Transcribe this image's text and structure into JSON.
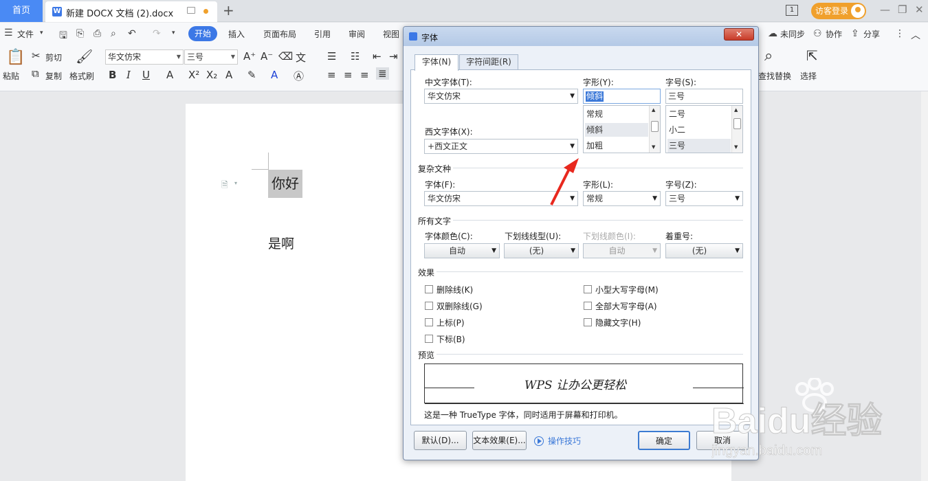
{
  "tabbar": {
    "home_label": "首页",
    "doc_icon": "W",
    "doc_name": "新建 DOCX 文档 (2).docx",
    "new_tab": "+",
    "page_count": "1",
    "login_label": "访客登录",
    "win_minimize": "—",
    "win_restore": "❐",
    "win_close": "✕"
  },
  "menubar": {
    "file_label": "文件",
    "start_label": "开始",
    "insert_label": "插入",
    "layout_label": "页面布局",
    "ref_label": "引用",
    "review_label": "审阅",
    "view_label": "视图",
    "sync_label": "未同步",
    "collab_label": "协作",
    "share_label": "分享"
  },
  "ribbon": {
    "paste_label": "粘贴",
    "cut_label": "剪切",
    "copy_label": "复制",
    "format_painter_label": "格式刷",
    "font_name": "华文仿宋",
    "font_size": "三号",
    "bold": "B",
    "italic": "I",
    "underline": "U",
    "find_replace_label": "查找替换",
    "select_label": "选择"
  },
  "document": {
    "line1": "你好",
    "line2": "是啊"
  },
  "dialog": {
    "title": "字体",
    "close": "✕",
    "tabs": [
      "字体(N)",
      "字符间距(R)"
    ],
    "cn_font_label": "中文字体(T):",
    "cn_font_value": "华文仿宋",
    "style_label": "字形(Y):",
    "style_value": "倾斜",
    "style_options": [
      "常规",
      "倾斜",
      "加粗"
    ],
    "size_label": "字号(S):",
    "size_value": "三号",
    "size_options": [
      "二号",
      "小二",
      "三号"
    ],
    "west_font_label": "西文字体(X):",
    "west_font_value": "+西文正文",
    "complex_section": "复杂文种",
    "complex_font_label": "字体(F):",
    "complex_font_value": "华文仿宋",
    "complex_style_label": "字形(L):",
    "complex_style_value": "常规",
    "complex_size_label": "字号(Z):",
    "complex_size_value": "三号",
    "all_text_section": "所有文字",
    "color_label": "字体颜色(C):",
    "color_value": "自动",
    "underline_label": "下划线线型(U):",
    "underline_value": "(无)",
    "underline_color_label": "下划线颜色(I):",
    "underline_color_value": "自动",
    "emphasis_label": "着重号:",
    "emphasis_value": "(无)",
    "effects_section": "效果",
    "effects_left": [
      "删除线(K)",
      "双删除线(G)",
      "上标(P)",
      "下标(B)"
    ],
    "effects_right": [
      "小型大写字母(M)",
      "全部大写字母(A)",
      "隐藏文字(H)"
    ],
    "preview_section": "预览",
    "preview_text": "WPS 让办公更轻松",
    "preview_note": "这是一种 TrueType 字体，同时适用于屏幕和打印机。",
    "default_btn": "默认(D)...",
    "text_effect_btn": "文本效果(E)...",
    "tips_label": "操作技巧",
    "ok_btn": "确定",
    "cancel_btn": "取消"
  },
  "watermark": {
    "brand": "Baidu经验",
    "url": "jingyan.baidu.com"
  }
}
